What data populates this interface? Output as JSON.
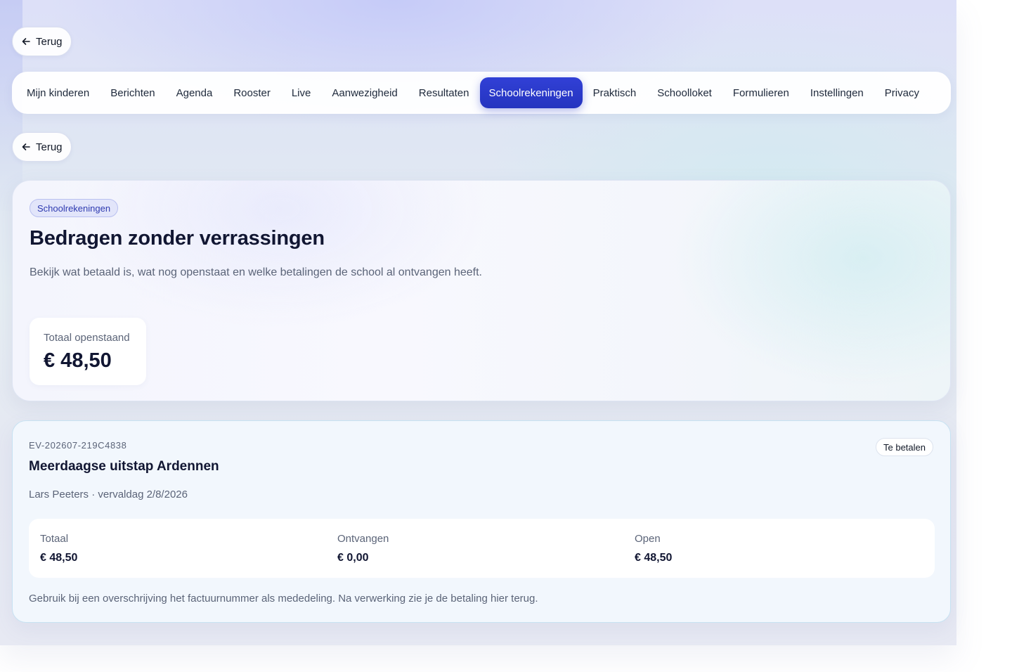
{
  "back_top": {
    "label": "Terug"
  },
  "back_second": {
    "label": "Terug"
  },
  "nav": {
    "items": [
      {
        "label": "Mijn kinderen",
        "active": false
      },
      {
        "label": "Berichten",
        "active": false
      },
      {
        "label": "Agenda",
        "active": false
      },
      {
        "label": "Rooster",
        "active": false
      },
      {
        "label": "Live",
        "active": false
      },
      {
        "label": "Aanwezigheid",
        "active": false
      },
      {
        "label": "Resultaten",
        "active": false
      },
      {
        "label": "Schoolrekeningen",
        "active": true
      },
      {
        "label": "Praktisch",
        "active": false
      },
      {
        "label": "Schoolloket",
        "active": false
      },
      {
        "label": "Formulieren",
        "active": false
      },
      {
        "label": "Instellingen",
        "active": false
      },
      {
        "label": "Privacy",
        "active": false
      }
    ],
    "active_color": "#2534bf"
  },
  "hero": {
    "tag": "Schoolrekeningen",
    "title": "Bedragen zonder verrassingen",
    "description": "Bekijk wat betaald is, wat nog openstaat en welke betalingen de school al ontvangen heeft.",
    "total_label": "Totaal openstaand",
    "total_value": "€ 48,50"
  },
  "invoice": {
    "number": "EV-202607-219C4838",
    "title": "Meerdaagse uitstap Ardennen",
    "meta": "Lars Peeters · vervaldag 2/8/2026",
    "status": "Te betalen",
    "amounts": {
      "total_label": "Totaal",
      "total_value": "€ 48,50",
      "received_label": "Ontvangen",
      "received_value": "€ 0,00",
      "open_label": "Open",
      "open_value": "€ 48,50"
    },
    "note": "Gebruik bij een overschrijving het factuurnummer als mededeling. Na verwerking zie je de betaling hier terug."
  },
  "icons": {
    "back": "arrow-left-icon"
  }
}
